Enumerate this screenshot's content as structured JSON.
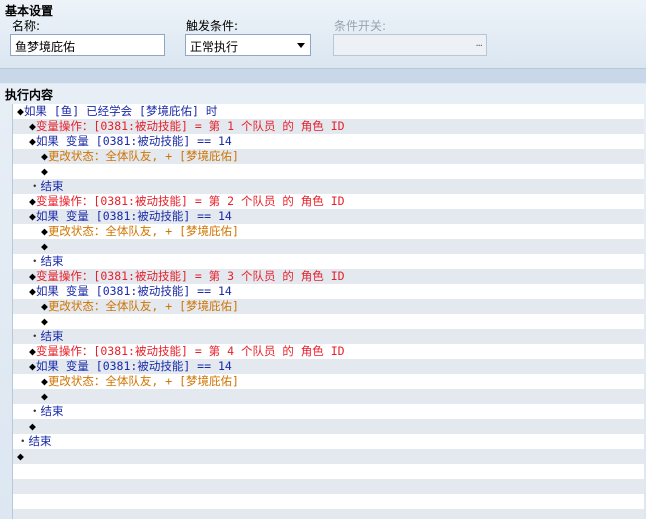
{
  "basic": {
    "title": "基本设置",
    "name_label": "名称:",
    "name_value": "鱼梦境庇佑",
    "trigger_label": "触发条件:",
    "trigger_value": "正常执行",
    "switch_label": "条件开关:",
    "switch_button": "..."
  },
  "exec": {
    "title": "执行内容",
    "rows": [
      {
        "bullet": "◆",
        "text": "如果 [鱼] 已经学会 [梦境庇佑] 时",
        "color": "blue",
        "indent": 0
      },
      {
        "bullet": "◆",
        "text": "变量操作：[0381:被动技能] = 第 1 个队员 的 角色 ID",
        "color": "red",
        "indent": 1
      },
      {
        "bullet": "◆",
        "text": "如果 变量 [0381:被动技能] == 14",
        "color": "blue",
        "indent": 1
      },
      {
        "bullet": "◆",
        "text": "更改状态：全体队友, + [梦境庇佑]",
        "color": "orange",
        "indent": 2
      },
      {
        "bullet": "◆",
        "text": "",
        "color": "blue",
        "indent": 2
      },
      {
        "bullet": "・",
        "text": "结束",
        "color": "blue",
        "indent": 1
      },
      {
        "bullet": "◆",
        "text": "变量操作：[0381:被动技能] = 第 2 个队员 的 角色 ID",
        "color": "red",
        "indent": 1
      },
      {
        "bullet": "◆",
        "text": "如果 变量 [0381:被动技能] == 14",
        "color": "blue",
        "indent": 1
      },
      {
        "bullet": "◆",
        "text": "更改状态：全体队友, + [梦境庇佑]",
        "color": "orange",
        "indent": 2
      },
      {
        "bullet": "◆",
        "text": "",
        "color": "blue",
        "indent": 2
      },
      {
        "bullet": "・",
        "text": "结束",
        "color": "blue",
        "indent": 1
      },
      {
        "bullet": "◆",
        "text": "变量操作：[0381:被动技能] = 第 3 个队员 的 角色 ID",
        "color": "red",
        "indent": 1
      },
      {
        "bullet": "◆",
        "text": "如果 变量 [0381:被动技能] == 14",
        "color": "blue",
        "indent": 1
      },
      {
        "bullet": "◆",
        "text": "更改状态：全体队友, + [梦境庇佑]",
        "color": "orange",
        "indent": 2
      },
      {
        "bullet": "◆",
        "text": "",
        "color": "blue",
        "indent": 2
      },
      {
        "bullet": "・",
        "text": "结束",
        "color": "blue",
        "indent": 1
      },
      {
        "bullet": "◆",
        "text": "变量操作：[0381:被动技能] = 第 4 个队员 的 角色 ID",
        "color": "red",
        "indent": 1
      },
      {
        "bullet": "◆",
        "text": "如果 变量 [0381:被动技能] == 14",
        "color": "blue",
        "indent": 1
      },
      {
        "bullet": "◆",
        "text": "更改状态：全体队友, + [梦境庇佑]",
        "color": "orange",
        "indent": 2
      },
      {
        "bullet": "◆",
        "text": "",
        "color": "blue",
        "indent": 2
      },
      {
        "bullet": "・",
        "text": "结束",
        "color": "blue",
        "indent": 1
      },
      {
        "bullet": "◆",
        "text": "",
        "color": "blue",
        "indent": 1
      },
      {
        "bullet": "・",
        "text": "结束",
        "color": "blue",
        "indent": 0
      },
      {
        "bullet": "◆",
        "text": "",
        "color": "blue",
        "indent": 0
      }
    ]
  },
  "colors": {
    "blue": "#1a2aa8",
    "red": "#e8202a",
    "orange": "#d07400",
    "row_alt": "#e3e9ef"
  }
}
